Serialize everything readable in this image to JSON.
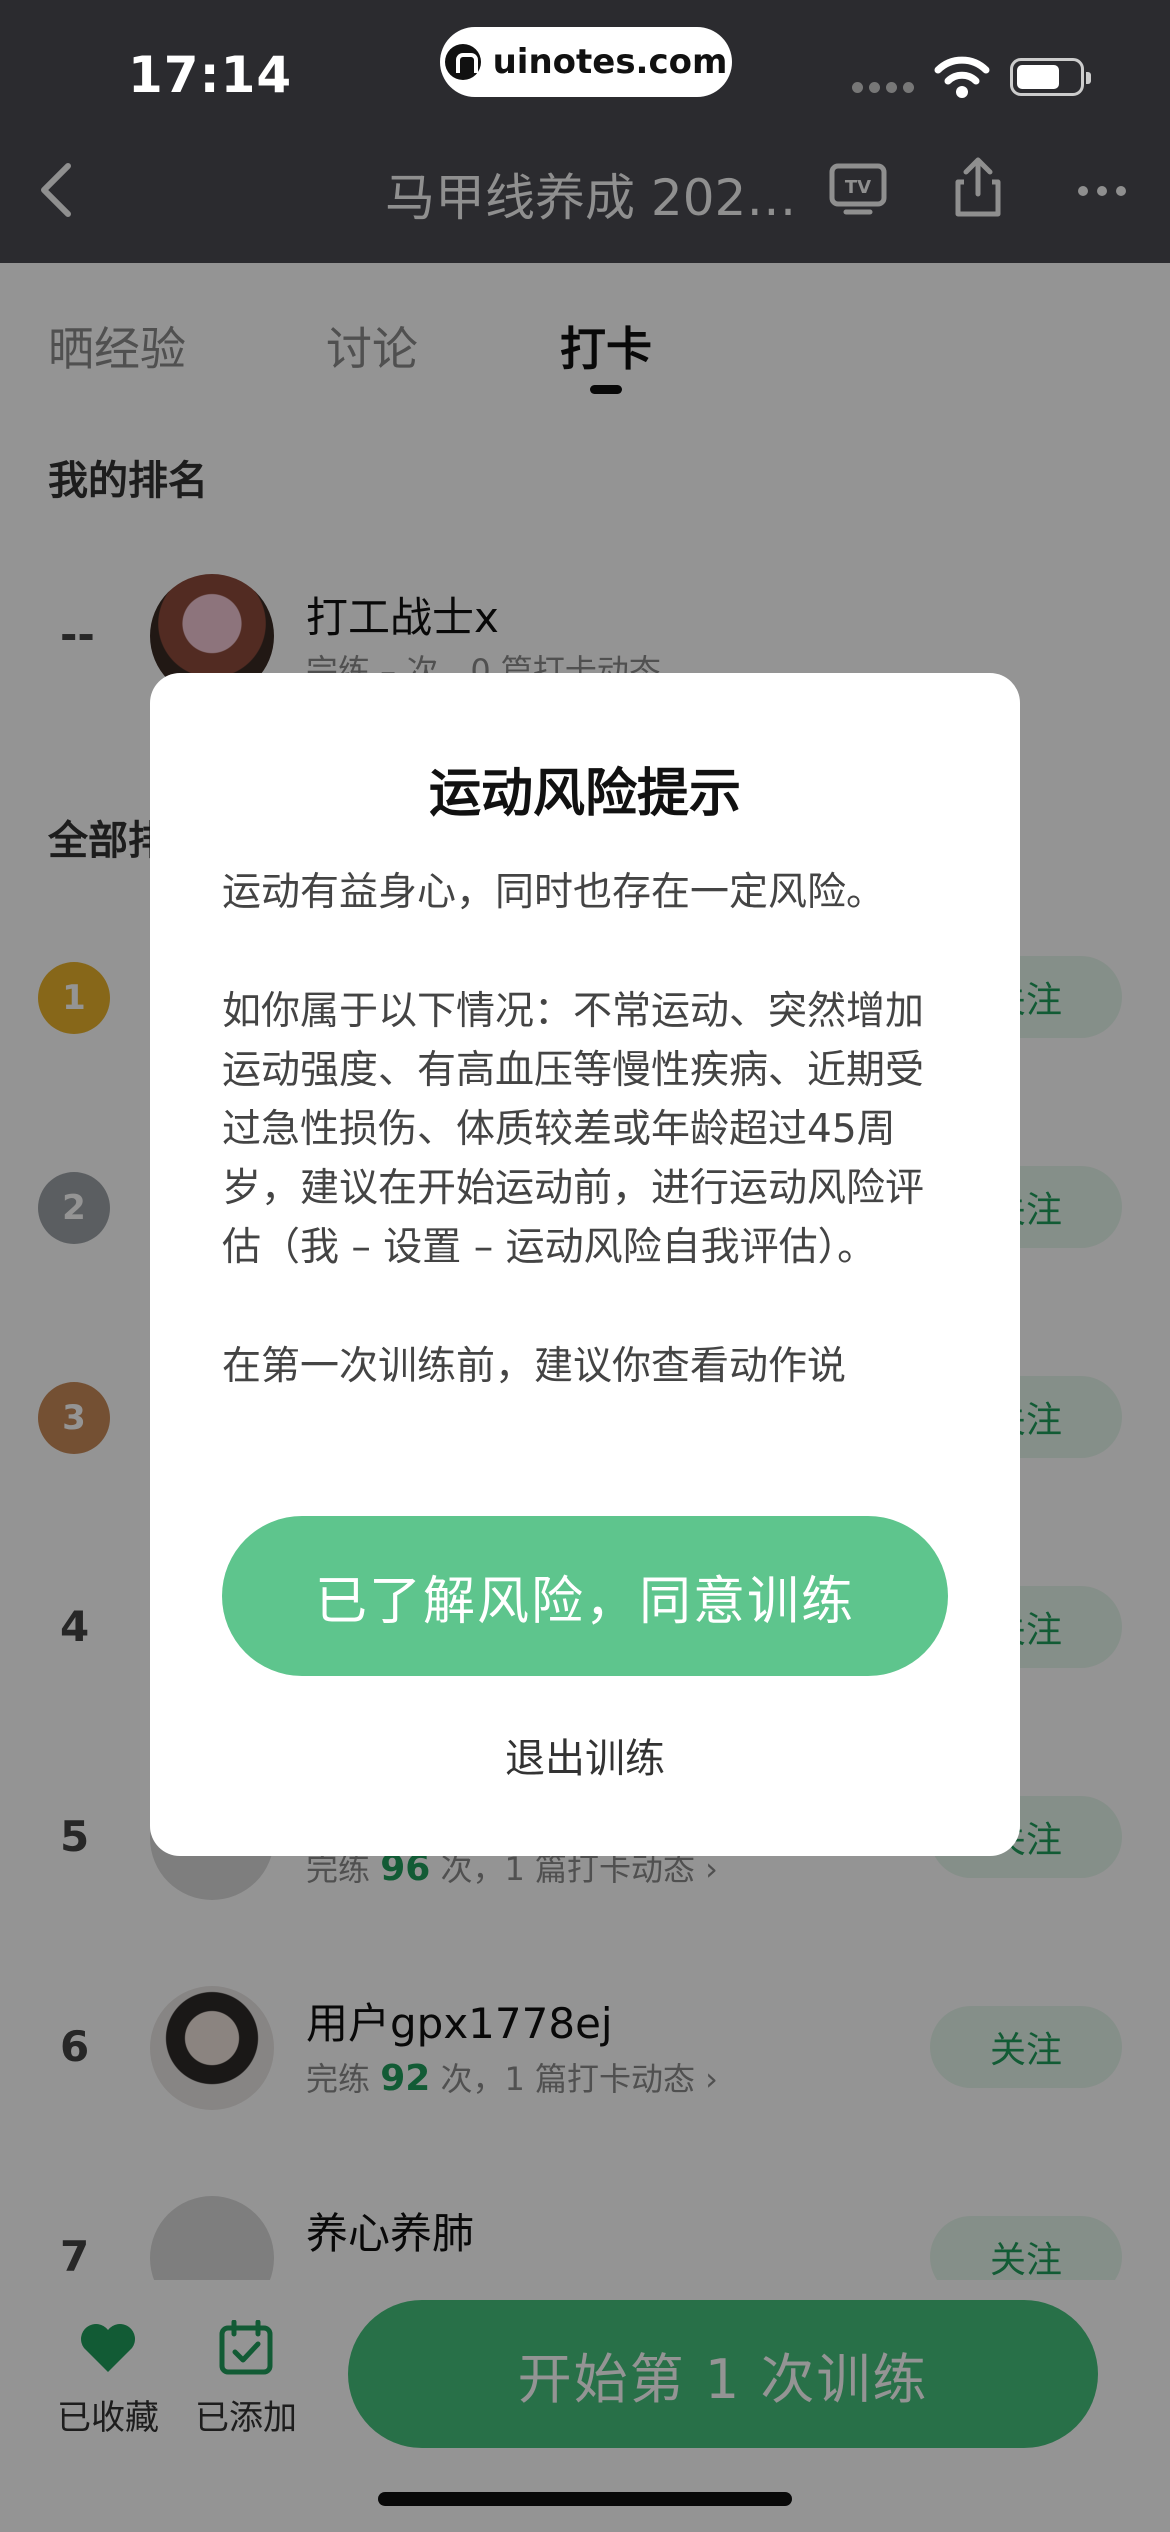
{
  "status_bar": {
    "time": "17:14",
    "url": "uinotes.com"
  },
  "nav": {
    "title": "马甲线养成 202…",
    "icons": [
      "back-icon",
      "tv-icon",
      "share-icon",
      "more-icon"
    ]
  },
  "tabs": [
    {
      "label": "晒经验"
    },
    {
      "label": "讨论"
    },
    {
      "label": "打卡"
    }
  ],
  "my_rank": {
    "section_title": "我的排名",
    "rank": "--",
    "name": "打工战士x",
    "stats_text": "完练 – 次，0 篇打卡动态"
  },
  "all_rank": {
    "section_title": "全部排名",
    "rows": [
      {
        "rank": "1",
        "follow": "关注"
      },
      {
        "rank": "2",
        "follow": "关注"
      },
      {
        "rank": "3",
        "follow": "关注"
      },
      {
        "rank": "4",
        "follow": "关注"
      },
      {
        "rank": "5",
        "stats_prefix": "完练",
        "count": "96",
        "stats_suffix": "次，1 篇打卡动态 ›",
        "follow": "关注"
      },
      {
        "rank": "6",
        "name": "用户gpx1778ej",
        "stats_prefix": "完练",
        "count": "92",
        "stats_suffix": "次，1 篇打卡动态 ›",
        "follow": "关注"
      },
      {
        "rank": "7",
        "name": "养心养肺",
        "follow": "关注"
      }
    ]
  },
  "bottom_bar": {
    "favorite_label": "已收藏",
    "added_label": "已添加",
    "start_button": "开始第 1 次训练"
  },
  "modal": {
    "title": "运动风险提示",
    "paragraphs": [
      "运动有益身心，同时也存在一定风险。",
      "如你属于以下情况：不常运动、突然增加运动强度、有高血压等慢性疾病、近期受过急性损伤、体质较差或年龄超过45周岁，建议在开始运动前，进行运动风险评估（我 – 设置 – 运动风险自我评估）。",
      "在第一次训练前，建议你查看动作说"
    ],
    "agree_button": "已了解风险，同意训练",
    "exit_link": "退出训练"
  },
  "colors": {
    "topbar": "#2b2b2f",
    "accent_green": "#5ec58d",
    "follow_text": "#1f9e5c"
  }
}
